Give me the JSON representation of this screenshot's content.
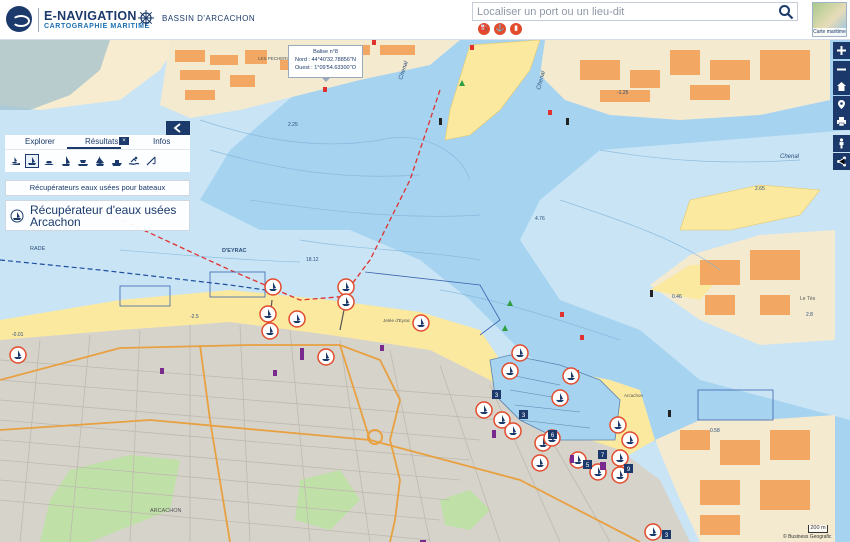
{
  "header": {
    "brand_title": "E-NAVIGATION",
    "brand_subtitle": "CARTOGRAPHIE MARITIME",
    "partner_name": "BASSIN D'ARCACHON"
  },
  "search": {
    "placeholder": "Localiser un port ou un lieu-dit",
    "value": ""
  },
  "layer_switch": {
    "label": "Carte maritime"
  },
  "panel": {
    "tabs": [
      {
        "label": "Explorer"
      },
      {
        "label": "Résultats"
      },
      {
        "label": "Infos"
      }
    ],
    "results_badge": "×",
    "active_tab": "Résultats",
    "category": "Récupérateurs eaux usées pour bateaux",
    "result": "Récupérateur d'eaux usées Arcachon"
  },
  "popup": {
    "title": "Balise n°8",
    "north": "Nord : 44°40'32.78856''N",
    "west": "Ouest : 1°09'54.63300''O"
  },
  "map_labels": {
    "channel_1": "Chenal",
    "channel_2": "Chenal",
    "channel_3": "Chenal",
    "rade": "RADE",
    "deyrac": "D'EYRAC",
    "arcachon": "ARCACHON",
    "les_pecheries": "LES PECHERIES",
    "jetee": "Jetée d'Eyrac",
    "port": "Arcachon",
    "le_teich": "Le Tès",
    "depths": [
      "2.25",
      "4.76",
      "2.65",
      "18.12",
      "0.46",
      "2.8",
      "-1.25",
      "-2.5",
      "0.58",
      "-0.01"
    ]
  },
  "scale": {
    "label": "200 m"
  },
  "attribution": "© Business Geografic",
  "colors": {
    "water": "#c9e4f5",
    "deep_water": "#a6d3f0",
    "land": "#f4ead0",
    "urban": "#d6d3cb",
    "sand": "#fbe9a0",
    "park": "#bfe0a6",
    "buildings": "#f2a763",
    "brand": "#1b3a6b",
    "accent": "#e24b2c"
  }
}
